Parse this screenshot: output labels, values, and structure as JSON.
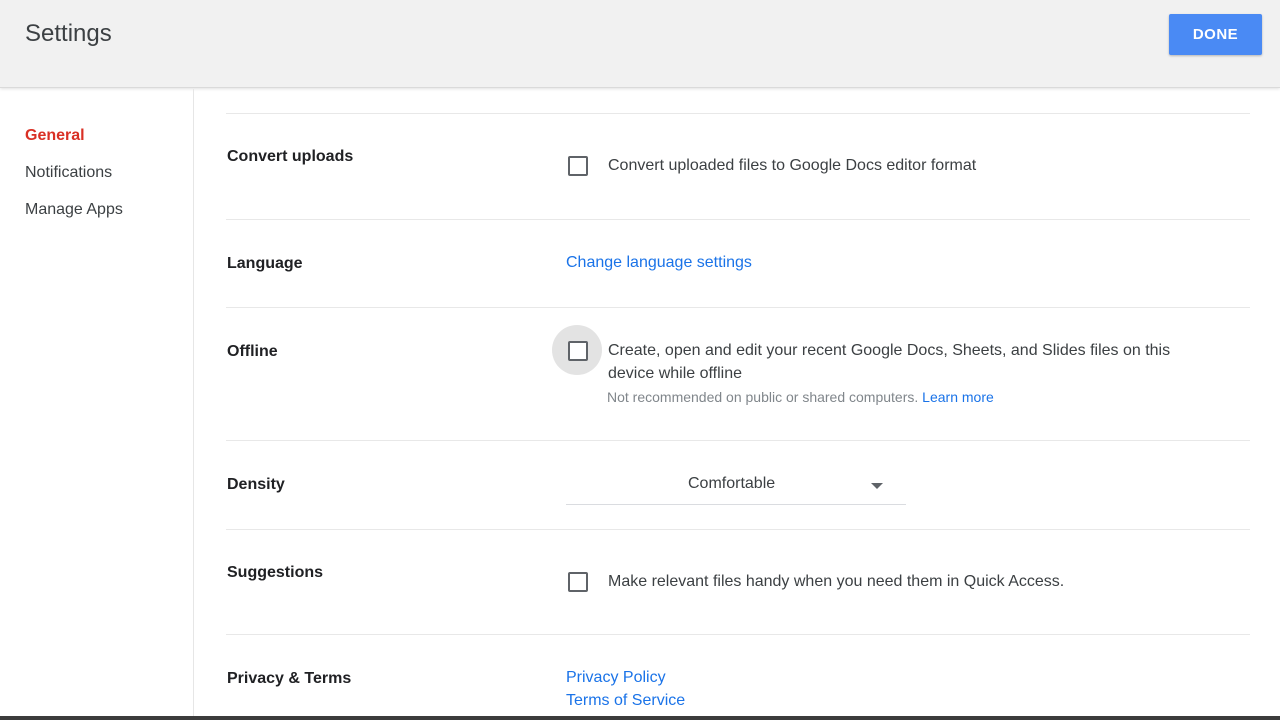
{
  "header": {
    "title": "Settings",
    "done_label": "DONE"
  },
  "sidebar": {
    "items": [
      {
        "label": "General",
        "active": true
      },
      {
        "label": "Notifications",
        "active": false
      },
      {
        "label": "Manage Apps",
        "active": false
      }
    ]
  },
  "settings": {
    "convert_uploads": {
      "label": "Convert uploads",
      "option_text": "Convert uploaded files to Google Docs editor format",
      "checked": false
    },
    "language": {
      "label": "Language",
      "link_text": "Change language settings"
    },
    "offline": {
      "label": "Offline",
      "option_line1": "Create, open and edit your recent Google Docs, Sheets, and Slides files on this",
      "option_line2": "device while offline",
      "note": "Not recommended on public or shared computers.",
      "learn_more": "Learn more",
      "checked": false
    },
    "density": {
      "label": "Density",
      "selected": "Comfortable"
    },
    "suggestions": {
      "label": "Suggestions",
      "option_text": "Make relevant files handy when you need them in Quick Access.",
      "checked": false
    },
    "privacy_terms": {
      "label": "Privacy & Terms",
      "privacy_link": "Privacy Policy",
      "terms_link": "Terms of Service"
    }
  },
  "colors": {
    "accent": "#4a8af4",
    "active_nav": "#d93025",
    "link": "#1a73e8"
  }
}
